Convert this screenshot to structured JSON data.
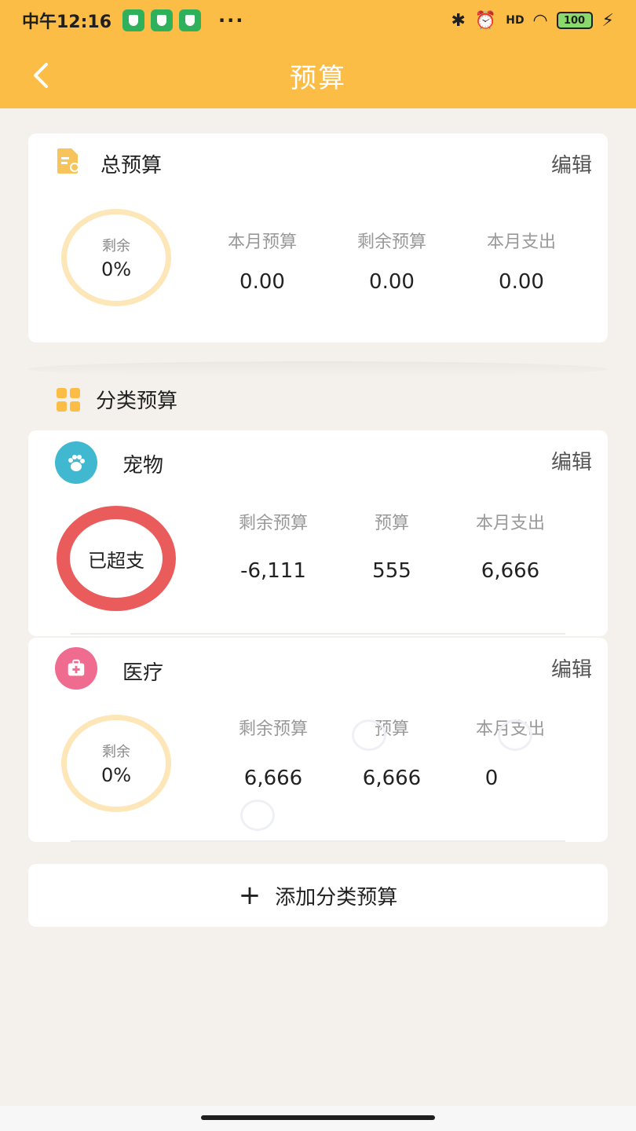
{
  "status_bar": {
    "time": "中午12:16",
    "dots": "···",
    "battery": "100",
    "signal_label": "HD"
  },
  "navbar": {
    "title": "预算"
  },
  "total_budget": {
    "title": "总预算",
    "edit_label": "编辑",
    "ring_label": "剩余",
    "ring_value": "0%",
    "stats": [
      {
        "label": "本月预算",
        "value": "0.00"
      },
      {
        "label": "剩余预算",
        "value": "0.00"
      },
      {
        "label": "本月支出",
        "value": "0.00"
      }
    ]
  },
  "category_section": {
    "title": "分类预算"
  },
  "categories": [
    {
      "name": "宠物",
      "icon": "paw-icon",
      "icon_color": "#3fb8d0",
      "edit_label": "编辑",
      "ring_text": "已超支",
      "ring_color": "#ea5c5c",
      "stats": [
        {
          "label": "剩余预算",
          "value": "-6,111"
        },
        {
          "label": "预算",
          "value": "555"
        },
        {
          "label": "本月支出",
          "value": "6,666"
        }
      ]
    },
    {
      "name": "医疗",
      "icon": "medical-kit-icon",
      "icon_color": "#ef6b8f",
      "edit_label": "编辑",
      "ring_label": "剩余",
      "ring_value": "0%",
      "stats": [
        {
          "label": "剩余预算",
          "value": "6,666"
        },
        {
          "label": "预算",
          "value": "6,666"
        },
        {
          "label": "本月支出",
          "value": "0"
        }
      ]
    }
  ],
  "add_button": {
    "plus": "+",
    "label": "添加分类预算"
  },
  "colors": {
    "accent": "#fbbd45",
    "background": "#f4f1ec",
    "over_budget": "#ea5c5c"
  }
}
